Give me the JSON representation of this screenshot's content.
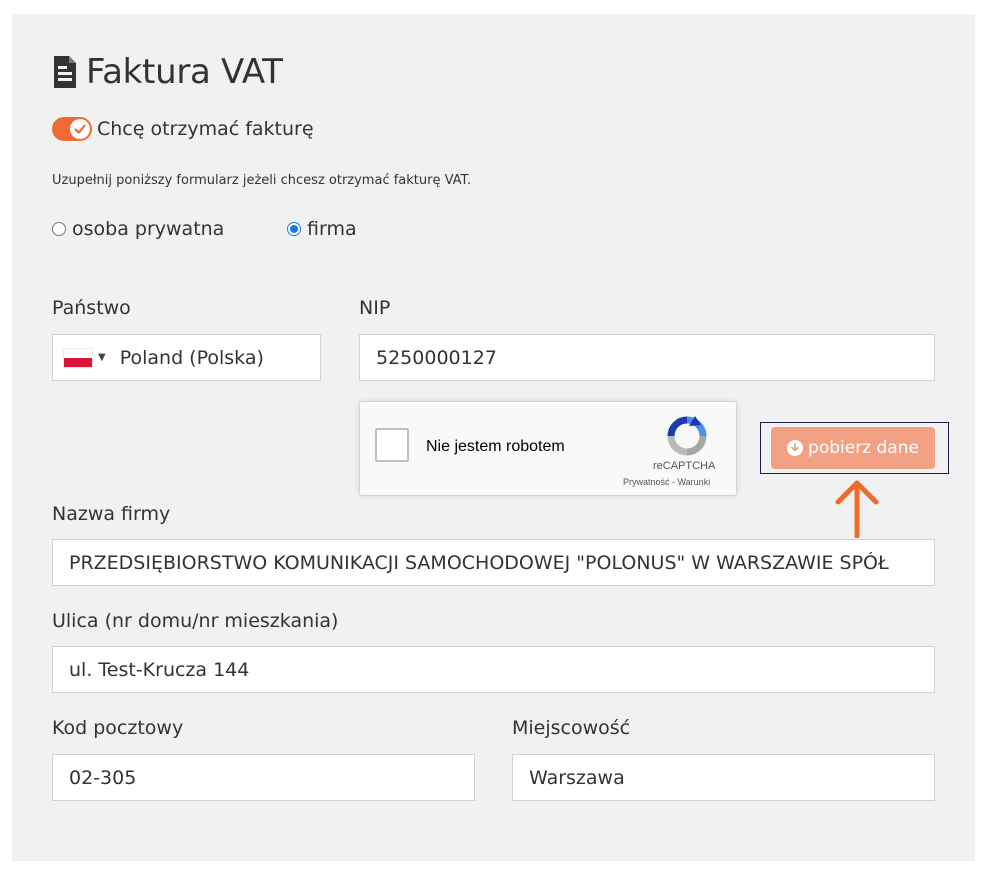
{
  "section": {
    "title": "Faktura VAT",
    "icon": "document-icon"
  },
  "invoice_toggle": {
    "label": "Chcę otrzymać fakturę",
    "checked": true
  },
  "helper_text": "Uzupełnij poniższy formularz jeżeli chcesz otrzymać fakturę VAT.",
  "customer_type": {
    "options": [
      {
        "label": "osoba prywatna",
        "checked": false
      },
      {
        "label": "firma",
        "checked": true
      }
    ]
  },
  "country": {
    "label": "Państwo",
    "value": "Poland (Polska)",
    "flag": "poland-flag-icon"
  },
  "nip": {
    "label": "NIP",
    "value": "5250000127"
  },
  "recaptcha": {
    "text": "Nie jestem robotem",
    "brand": "reCAPTCHA",
    "terms": "Prywatność - Warunki"
  },
  "fetch_button": {
    "label": "pobierz dane",
    "icon": "arrow-circle-down-icon"
  },
  "company_name": {
    "label": "Nazwa firmy",
    "value": "PRZEDSIĘBIORSTWO KOMUNIKACJI SAMOCHODOWEJ \"POLONUS\" W WARSZAWIE SPÓŁ"
  },
  "street": {
    "label": "Ulica (nr domu/nr mieszkania)",
    "value": "ul. Test-Krucza 144"
  },
  "postal_code": {
    "label": "Kod pocztowy",
    "value": "02-305"
  },
  "city": {
    "label": "Miejscowość",
    "value": "Warszawa"
  },
  "colors": {
    "accent": "#ef6b35",
    "button": "#f2a184",
    "panel": "#f1f1f1"
  }
}
